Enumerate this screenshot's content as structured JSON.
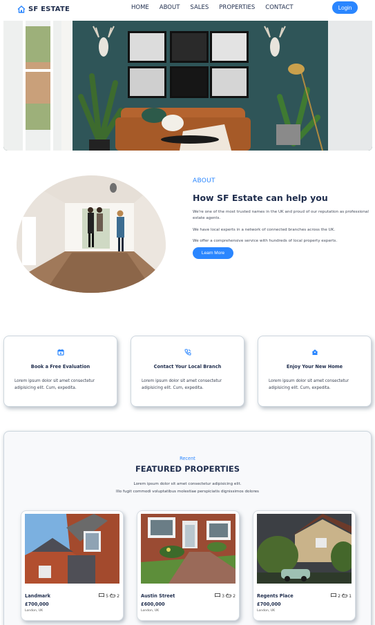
{
  "brand": {
    "name": "SF ESTATE"
  },
  "nav": {
    "items": [
      "HOME",
      "ABOUT",
      "SALES",
      "PROPERTIES",
      "CONTACT"
    ],
    "login_label": "Login"
  },
  "colors": {
    "accent": "#2a86ff",
    "navy": "#1f2d4d",
    "wall": "#2f5558"
  },
  "about": {
    "eyebrow": "ABOUT",
    "title": "How SF Estate can help you",
    "p1": "We're one of the most trusted names in the UK and proud of our reputation as professional estate agents.",
    "p2": "We have local experts in a network of connected branches across the UK.",
    "p3": "We offer a comprehensive service with hundreds of local property experts.",
    "cta_label": "Learn More"
  },
  "services": [
    {
      "icon": "calendar-icon",
      "title": "Book a Free Evaluation",
      "text": "Lorem ipsum dolor sit amet consectetur adipisicing elit. Cum, expedita."
    },
    {
      "icon": "phone-icon",
      "title": "Contact Your Local Branch",
      "text": "Lorem ipsum dolor sit amet consectetur adipisicing elit. Cum, expedita."
    },
    {
      "icon": "home-icon",
      "title": "Enjoy Your New Home",
      "text": "Lorem ipsum dolor sit amet consectetur adipisicing elit. Cum, expedita."
    }
  ],
  "featured": {
    "eyebrow": "Recent",
    "title": "FEATURED PROPERTIES",
    "p1": "Lorem ipsum dolor sit amet consectetur adipisicing elit.",
    "p2": "Illo fugit commodi voluptatibus molestiae perspiciatis dignissimos dolores",
    "properties": [
      {
        "name": "Landmark",
        "price": "£700,000",
        "location": "London, UK",
        "beds": "5",
        "baths": "2"
      },
      {
        "name": "Austin Street",
        "price": "£600,000",
        "location": "London, UK",
        "beds": "3",
        "baths": "2"
      },
      {
        "name": "Regents Place",
        "price": "£700,000",
        "location": "London, UK",
        "beds": "2",
        "baths": "1"
      }
    ]
  }
}
